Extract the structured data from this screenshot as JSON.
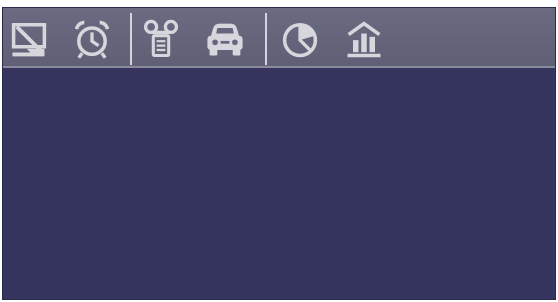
{
  "colors": {
    "toolbar_bg": "#666680",
    "icon_fill": "#d6d6dc",
    "content_bg": "#34345f",
    "separator": "#d4d4dc"
  },
  "toolbar": {
    "groups": [
      [
        "display-off-icon",
        "alarm-clock-icon"
      ],
      [
        "voicemail-icon",
        "car-icon"
      ],
      [
        "pie-chart-icon",
        "bank-icon"
      ]
    ]
  }
}
